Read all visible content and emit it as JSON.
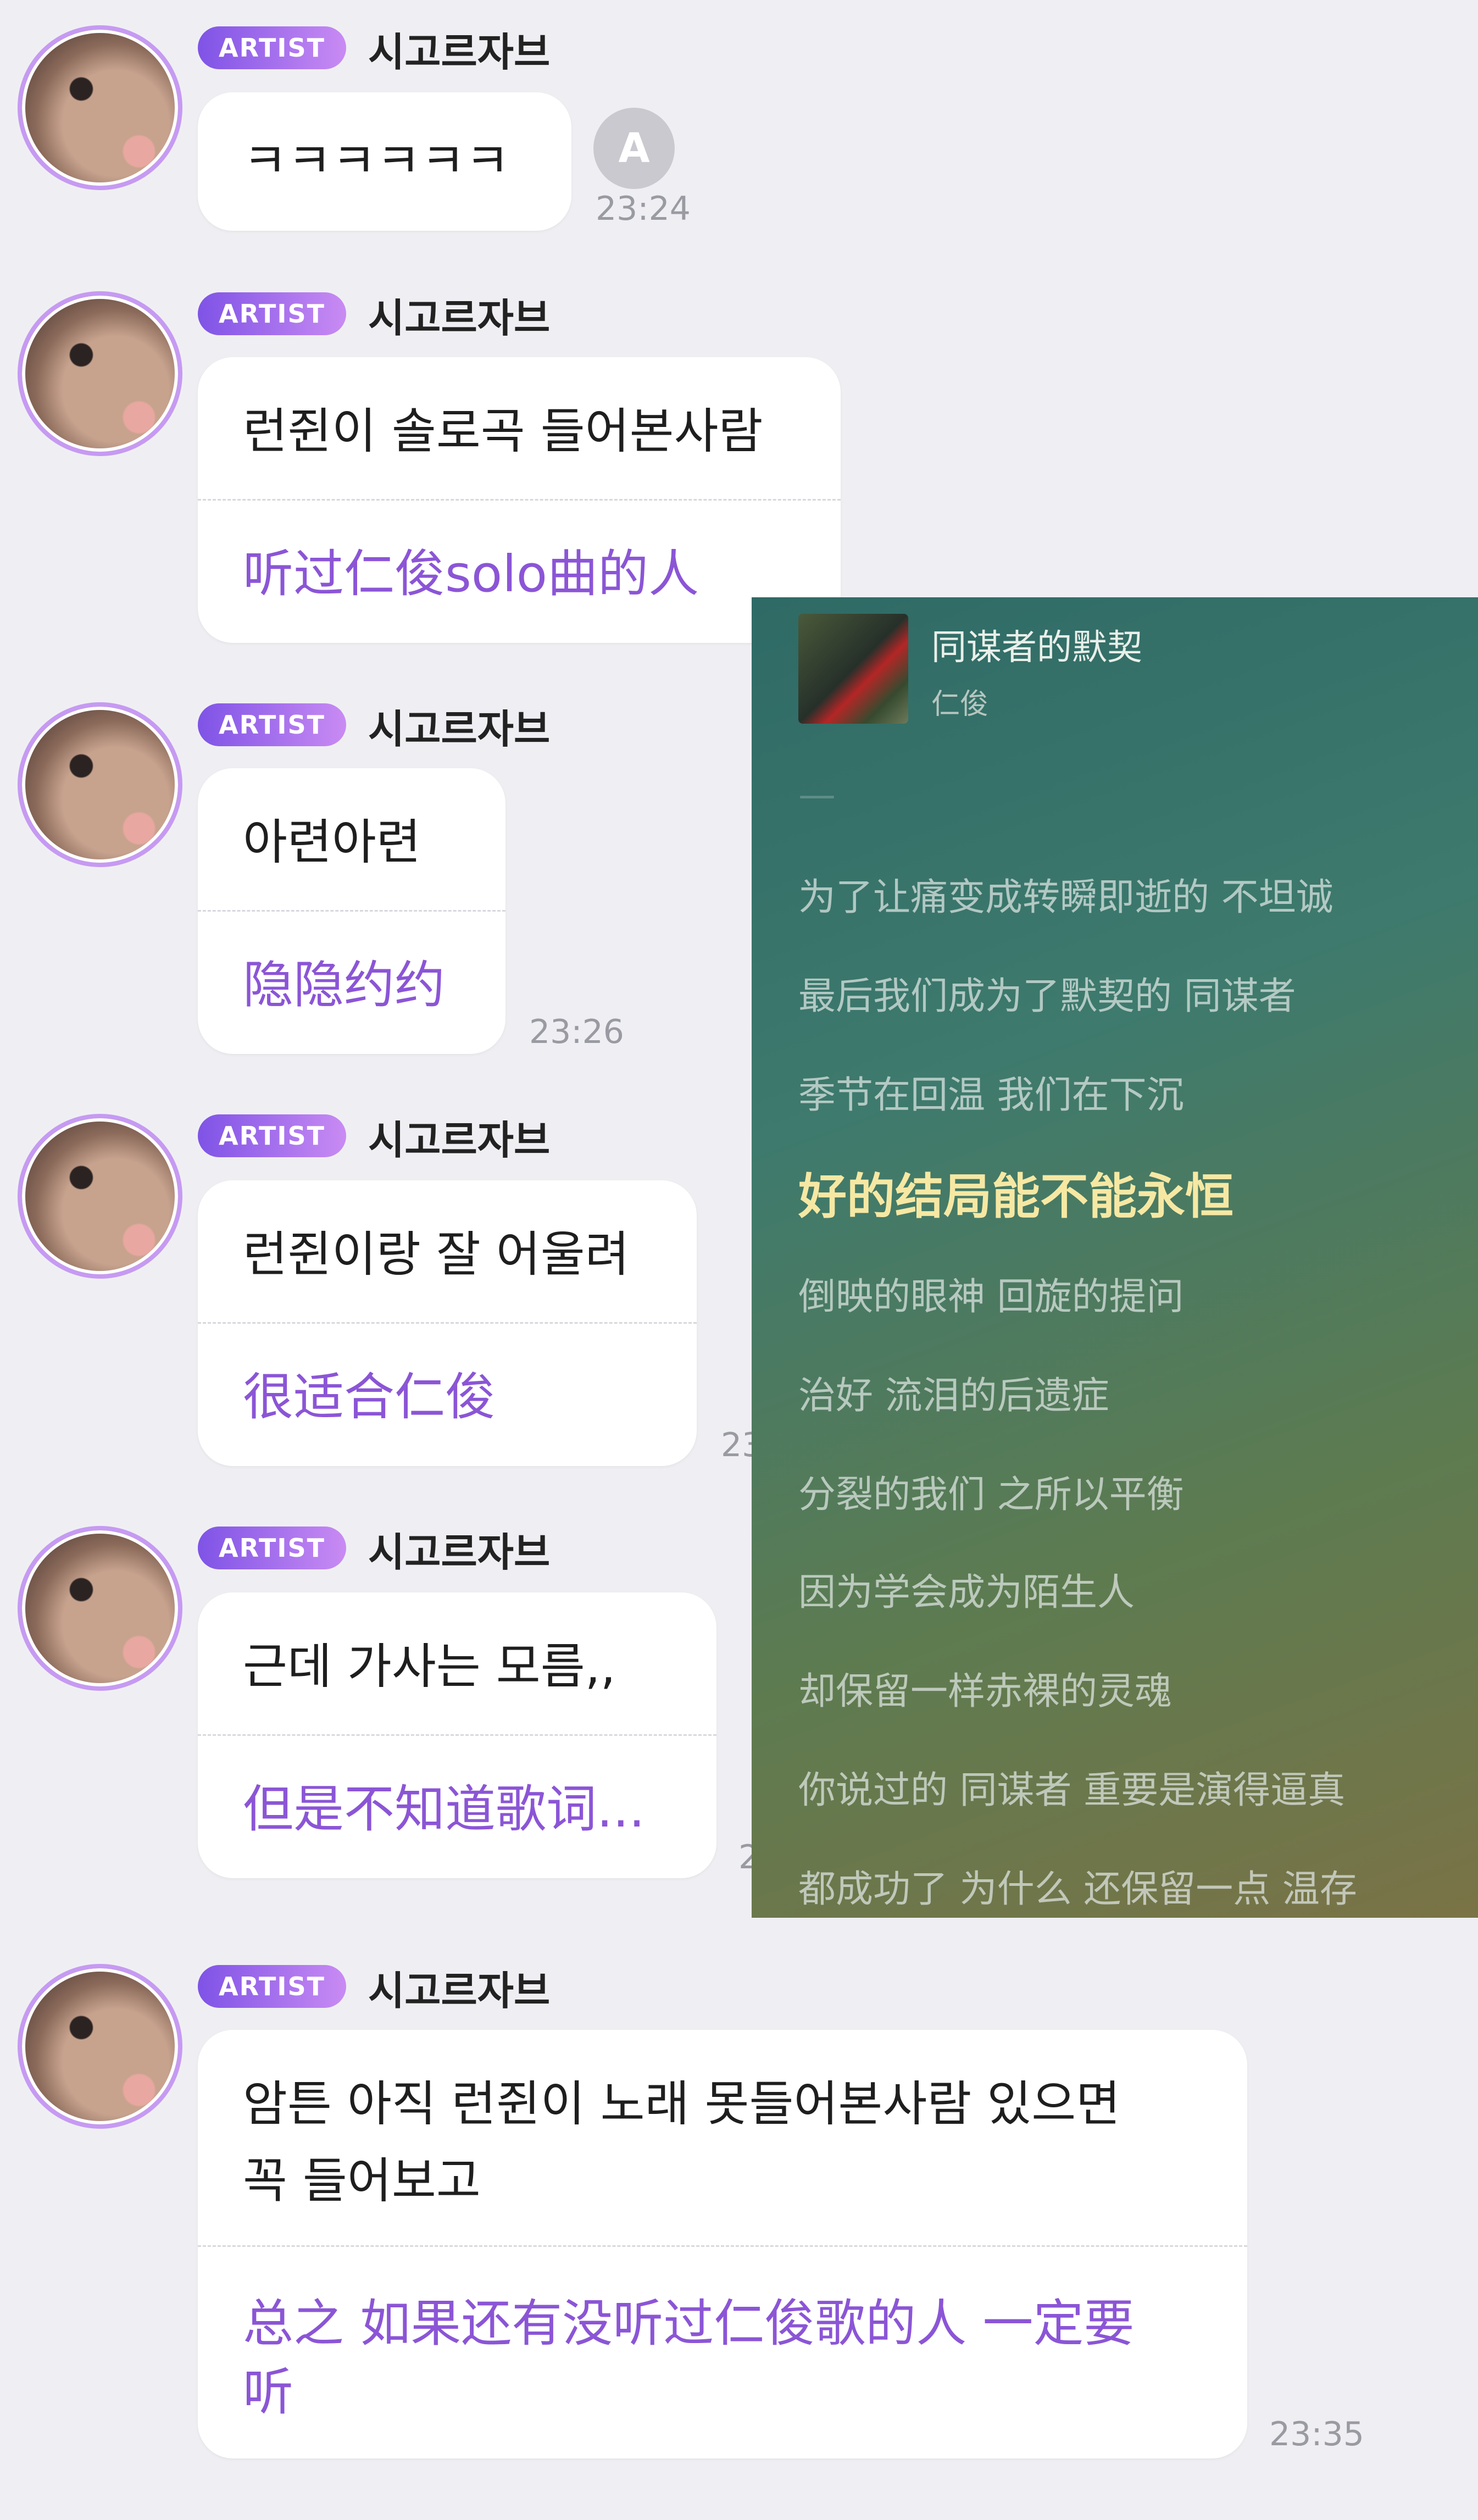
{
  "chat": {
    "messages": [
      {
        "badge": "ARTIST",
        "name": "시고르자브",
        "ko": "ㅋㅋㅋㅋㅋㅋ",
        "zh": "",
        "time": "23:24",
        "translate_icon": "A"
      },
      {
        "badge": "ARTIST",
        "name": "시고르자브",
        "ko": "런쥔이 솔로곡 들어본사람",
        "zh": "听过仁俊solo曲的人",
        "time": ""
      },
      {
        "badge": "ARTIST",
        "name": "시고르자브",
        "ko": "아련아련",
        "zh": "隐隐约约",
        "time": "23:26"
      },
      {
        "badge": "ARTIST",
        "name": "시고르자브",
        "ko": "런쥔이랑 잘 어울려",
        "zh": "很适合仁俊",
        "time": "23"
      },
      {
        "badge": "ARTIST",
        "name": "시고르자브",
        "ko": "근데 가사는 모름,,",
        "zh": "但是不知道歌词...",
        "time": "2"
      },
      {
        "badge": "ARTIST",
        "name": "시고르자브",
        "ko": "암튼 아직 런쥔이 노래 못들어본사람 있으면",
        "ko2": "꼭 들어보고",
        "zh": "总之 如果还有没听过仁俊歌的人 一定要",
        "zh2": "听",
        "time": "23:35"
      }
    ]
  },
  "lyrics_panel": {
    "song_title": "同谋者的默契",
    "artist": "仁俊",
    "lines": [
      "为了让痛变成转瞬即逝的 不坦诚",
      "最后我们成为了默契的 同谋者",
      "季节在回温 我们在下沉",
      "好的结局能不能永恒",
      "倒映的眼神 回旋的提问",
      "治好 流泪的后遗症",
      "分裂的我们 之所以平衡",
      "因为学会成为陌生人",
      "却保留一样赤裸的灵魂",
      "你说过的 同谋者 重要是演得逼真",
      "都成功了 为什么 还保留一点 温存"
    ],
    "active_line_index": 3,
    "colors": {
      "active": "#f6e8a3",
      "accent": "#8b55d6"
    }
  }
}
